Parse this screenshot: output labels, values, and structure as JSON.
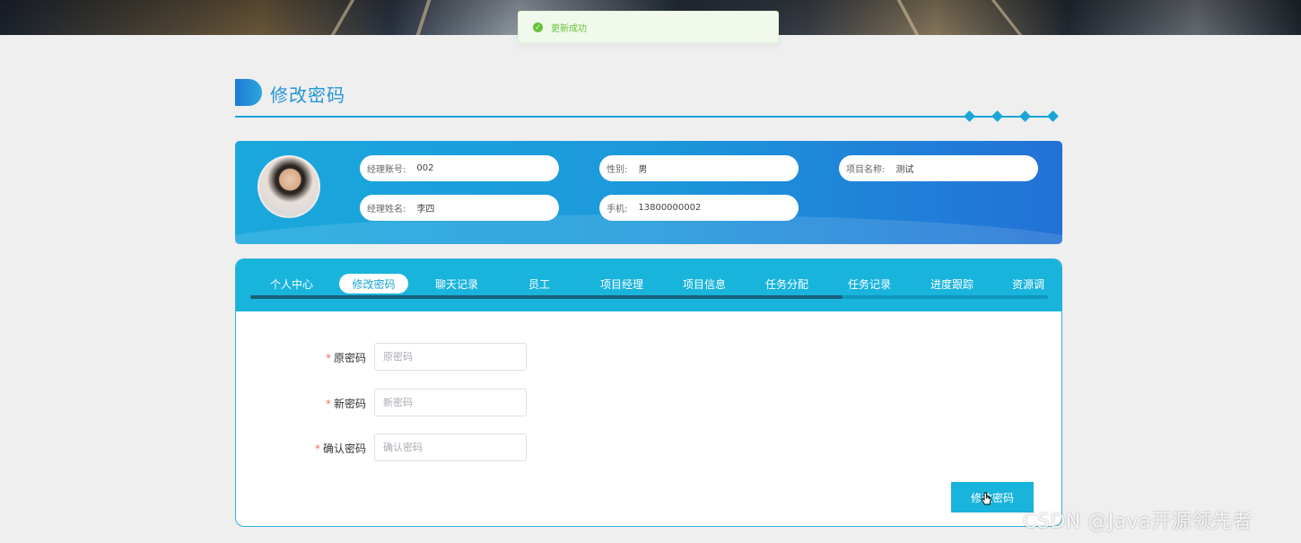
{
  "toast": {
    "message": "更新成功",
    "color": "#67c23a"
  },
  "page": {
    "title": "修改密码"
  },
  "profile": {
    "fields": [
      {
        "label": "经理账号:",
        "value": "002"
      },
      {
        "label": "性别:",
        "value": "男"
      },
      {
        "label": "项目名称:",
        "value": "测试"
      },
      {
        "label": "经理姓名:",
        "value": "李四"
      },
      {
        "label": "手机:",
        "value": "13800000002"
      }
    ]
  },
  "tabs": [
    {
      "label": "个人中心",
      "active": false
    },
    {
      "label": "修改密码",
      "active": true
    },
    {
      "label": "聊天记录",
      "active": false
    },
    {
      "label": "员工",
      "active": false
    },
    {
      "label": "项目经理",
      "active": false
    },
    {
      "label": "项目信息",
      "active": false
    },
    {
      "label": "任务分配",
      "active": false
    },
    {
      "label": "任务记录",
      "active": false
    },
    {
      "label": "进度跟踪",
      "active": false
    },
    {
      "label": "资源调",
      "active": false
    }
  ],
  "form": {
    "fields": [
      {
        "label": "原密码",
        "placeholder": "原密码",
        "value": ""
      },
      {
        "label": "新密码",
        "placeholder": "新密码",
        "value": ""
      },
      {
        "label": "确认密码",
        "placeholder": "确认密码",
        "value": ""
      }
    ],
    "required_mark": "*",
    "submit_label": "修改密码"
  },
  "watermark": "CSDN @Java开源领先者",
  "colors": {
    "accent": "#19b4dc",
    "title": "#2496d6",
    "required": "#f56c6c"
  }
}
